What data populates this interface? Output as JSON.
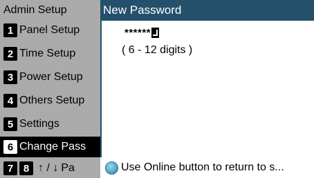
{
  "menu": {
    "title": "Admin Setup",
    "items": [
      {
        "num": "1",
        "label": "Panel Setup"
      },
      {
        "num": "2",
        "label": "Time Setup"
      },
      {
        "num": "3",
        "label": "Power Setup"
      },
      {
        "num": "4",
        "label": "Others Setup"
      },
      {
        "num": "5",
        "label": "Settings"
      },
      {
        "num": "6",
        "label": "Change Pass"
      }
    ],
    "selected_index": 5,
    "nav": {
      "num_a": "7",
      "num_b": "8",
      "arrows": "↑ / ↓",
      "label": "Pa"
    }
  },
  "panel": {
    "title": "New Password",
    "password_mask": "******",
    "hint": "( 6 - 12 digits )",
    "footer": "Use Online button to return to s..."
  },
  "colors": {
    "header_bg": "#24506b",
    "online_icon": "#5aa9cf"
  },
  "icons": {
    "cursor": "enter-cursor-icon",
    "online": "online-button-icon"
  }
}
